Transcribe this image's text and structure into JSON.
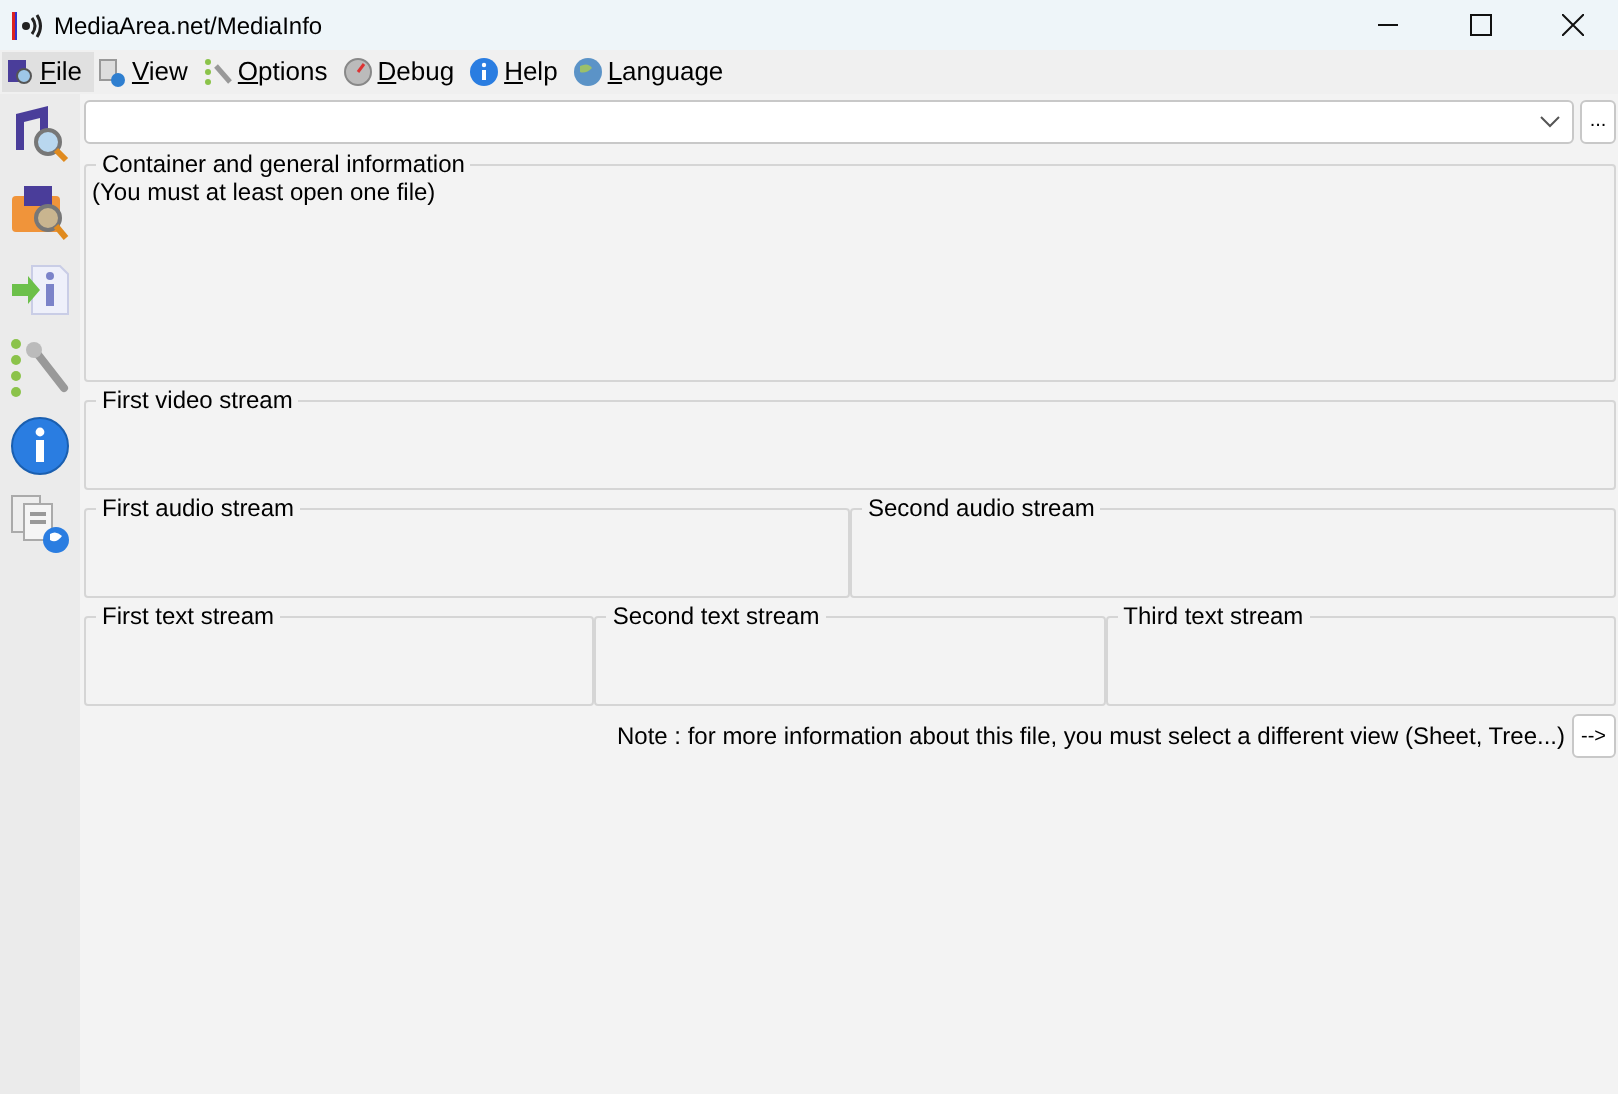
{
  "window": {
    "title": "MediaArea.net/MediaInfo"
  },
  "menu": [
    {
      "label": "File",
      "selected": true
    },
    {
      "label": "View",
      "selected": false
    },
    {
      "label": "Options",
      "selected": false
    },
    {
      "label": "Debug",
      "selected": false
    },
    {
      "label": "Help",
      "selected": false
    },
    {
      "label": "Language",
      "selected": false
    }
  ],
  "file_selector": {
    "browse_label": "..."
  },
  "sections": [
    {
      "groups": [
        {
          "title": "Container and general information",
          "text": "(You must at least open one file)"
        }
      ]
    },
    {
      "groups": [
        {
          "title": "First video stream"
        }
      ]
    },
    {
      "groups": [
        {
          "title": "First audio stream"
        },
        {
          "title": "Second audio stream"
        }
      ]
    },
    {
      "groups": [
        {
          "title": "First text stream"
        },
        {
          "title": "Second text stream"
        },
        {
          "title": "Third text stream"
        }
      ]
    }
  ],
  "note": {
    "text": "Note : for more information about this file, you must select a different view (Sheet, Tree...)",
    "button": "-->"
  }
}
